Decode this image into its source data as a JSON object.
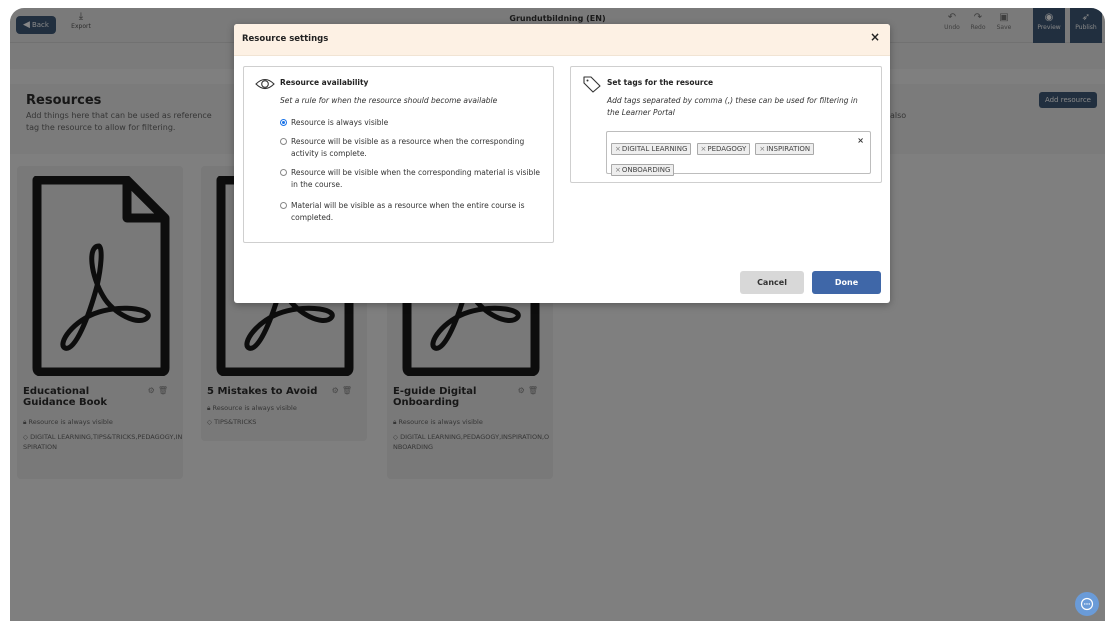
{
  "topbar": {
    "back_label": "Back",
    "export_label": "Export",
    "title": "Grundutbildning (EN)",
    "tools": [
      {
        "icon": "undo-icon",
        "label": "Undo"
      },
      {
        "icon": "redo-icon",
        "label": "Redo"
      },
      {
        "icon": "save-icon",
        "label": "Save"
      },
      {
        "icon": "eye-icon",
        "label": "Preview"
      },
      {
        "icon": "rocket-icon",
        "label": "Publish"
      }
    ]
  },
  "resources": {
    "title": "Resources",
    "description": "Add things here that can be used as reference tag the resource to allow for filtering.",
    "description_line1": "Add things here that can be used as reference",
    "description_line2": "tag the resource to allow for filtering.",
    "description_tail": "also",
    "add_button": "Add resource"
  },
  "cards": [
    {
      "name": "Educational Guidance Book",
      "visibility": "Resource is always visible",
      "tags": "DIGITAL LEARNING,TIPS&TRICKS,PEDAGOGY,INSPIRATION"
    },
    {
      "name": "5 Mistakes to Avoid",
      "visibility": "Resource is always visible",
      "tags": "TIPS&TRICKS"
    },
    {
      "name": "E-guide Digital Onboarding",
      "visibility": "Resource is always visible",
      "tags": "DIGITAL LEARNING,PEDAGOGY,INSPIRATION,ONBOARDING"
    }
  ],
  "modal": {
    "title": "Resource settings",
    "close_label": "×",
    "availability": {
      "title": "Resource availability",
      "subtitle": "Set a rule for when the resource should become available",
      "options": [
        {
          "label": "Resource is always visible",
          "selected": true
        },
        {
          "label": "Resource will be visible as a resource when the corresponding activity is complete.",
          "selected": false
        },
        {
          "label": "Resource will be visible when the corresponding material is visible in the course.",
          "selected": false
        },
        {
          "label": "Material will be visible as a resource when the entire course is completed.",
          "selected": false
        }
      ]
    },
    "tags": {
      "title": "Set tags for the resource",
      "subtitle": "Add tags separated by comma (,) these can be used for filtering in the Learner Portal",
      "items": [
        "DIGITAL LEARNING",
        "PEDAGOGY",
        "INSPIRATION",
        "ONBOARDING"
      ],
      "remove_symbol": "×",
      "clear_symbol": "×"
    },
    "cancel_label": "Cancel",
    "done_label": "Done"
  },
  "colors": {
    "primary_dark": "#3f5a78",
    "done_button": "#3f67a8",
    "modal_header": "#fdf1e4",
    "radio_selected": "#1a73e8",
    "chat_bubble": "#6a9bd8"
  }
}
